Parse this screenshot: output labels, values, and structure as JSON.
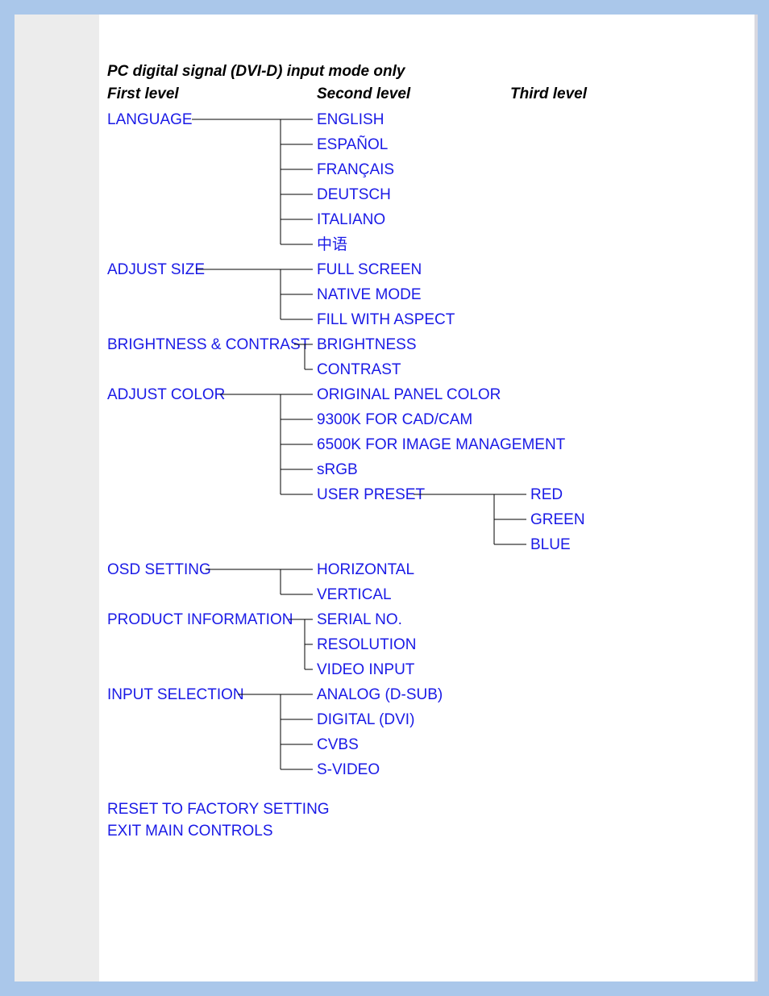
{
  "title": "PC digital signal (DVI-D) input mode only",
  "headers": {
    "h1": "First level",
    "h2": "Second level",
    "h3": "Third level"
  },
  "menu": {
    "language": {
      "label": "LANGUAGE",
      "items": [
        "ENGLISH",
        "ESPAÑOL",
        "FRANÇAIS",
        "DEUTSCH",
        "ITALIANO",
        "中语"
      ]
    },
    "adjust_size": {
      "label": "ADJUST SIZE",
      "items": [
        "FULL SCREEN",
        "NATIVE MODE",
        "FILL WITH ASPECT"
      ]
    },
    "brightness_contrast": {
      "label": "BRIGHTNESS & CONTRAST",
      "items": [
        "BRIGHTNESS",
        "CONTRAST"
      ]
    },
    "adjust_color": {
      "label": "ADJUST COLOR",
      "items": [
        "ORIGINAL PANEL COLOR",
        "9300K FOR CAD/CAM",
        "6500K FOR IMAGE MANAGEMENT",
        "sRGB",
        "USER PRESET"
      ],
      "user_preset_items": [
        "RED",
        "GREEN",
        "BLUE"
      ]
    },
    "osd_setting": {
      "label": "OSD SETTING",
      "items": [
        "HORIZONTAL",
        "VERTICAL"
      ]
    },
    "product_information": {
      "label": "PRODUCT INFORMATION",
      "items": [
        "SERIAL NO.",
        "RESOLUTION",
        "VIDEO INPUT"
      ]
    },
    "input_selection": {
      "label": "INPUT SELECTION",
      "items": [
        "ANALOG (D-SUB)",
        "DIGITAL (DVI)",
        "CVBS",
        "S-VIDEO"
      ]
    },
    "reset": "RESET TO FACTORY SETTING",
    "exit": "EXIT MAIN CONTROLS"
  }
}
